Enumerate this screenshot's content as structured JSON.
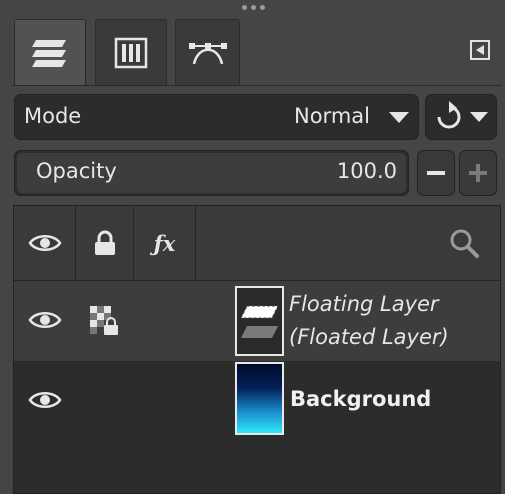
{
  "tabs": [
    {
      "name": "layers-tab",
      "icon": "layers-stack-icon",
      "active": true
    },
    {
      "name": "channels-tab",
      "icon": "channels-icon",
      "active": false
    },
    {
      "name": "paths-tab",
      "icon": "paths-icon",
      "active": false
    }
  ],
  "mode": {
    "label": "Mode",
    "value": "Normal"
  },
  "opacity": {
    "label": "Opacity",
    "value": "100.0"
  },
  "header_icons": [
    "eye-icon",
    "lock-icon",
    "fx-icon",
    "search-icon"
  ],
  "fx_label": "ƒx",
  "layers": [
    {
      "line1": "Floating Layer",
      "line2": "(Floated Layer)",
      "visible": true,
      "style": "italic"
    },
    {
      "name": "Background",
      "visible": true,
      "style": "bold"
    }
  ],
  "colors": {
    "panel": "#454545",
    "field": "#2c2c2c",
    "text": "#e6e6e6"
  }
}
